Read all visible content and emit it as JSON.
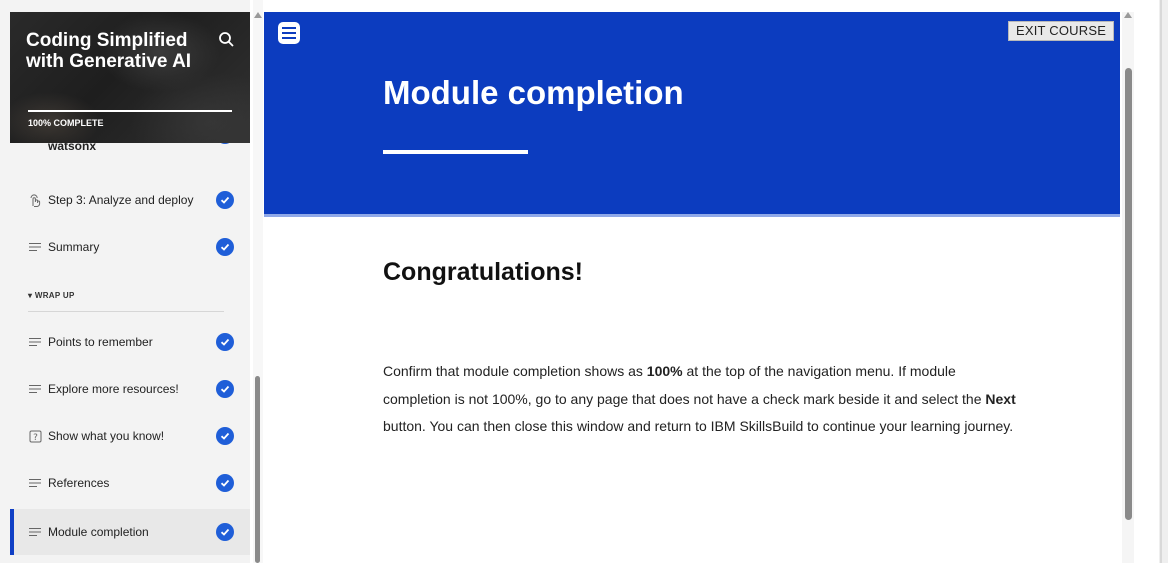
{
  "sidebar": {
    "course_title": "Coding Simplified with Generative AI",
    "progress_label": "100% COMPLETE",
    "progress": 1.0,
    "search_icon": "search-icon",
    "partial_item_label": "watsonx",
    "items": [
      {
        "label": "Step 3: Analyze and deploy",
        "icon": "touch-icon",
        "completed": true
      },
      {
        "label": "Summary",
        "icon": "lines-icon",
        "completed": true
      },
      {
        "label": "Points to remember",
        "icon": "lines-icon",
        "completed": true
      },
      {
        "label": "Explore more resources!",
        "icon": "lines-icon",
        "completed": true
      },
      {
        "label": "Show what you know!",
        "icon": "question-icon",
        "completed": true
      },
      {
        "label": "References",
        "icon": "lines-icon",
        "completed": true
      },
      {
        "label": "Module completion",
        "icon": "lines-icon",
        "completed": true,
        "active": true
      }
    ],
    "section_label": "WRAP UP"
  },
  "header": {
    "exit_label": "EXIT COURSE",
    "page_title": "Module completion"
  },
  "content": {
    "heading": "Congratulations!",
    "p1": "Confirm that module completion shows as ",
    "p1_bold": "100%",
    "p2": " at the top of the navigation menu. If module completion is not 100%, go to any page that does not have a check mark beside it and select the ",
    "p2_bold": "Next",
    "p3": " button. You can then close this window and return to IBM SkillsBuild to continue your learning journey."
  },
  "colors": {
    "banner": "#0c3cbf",
    "check": "#1f5ed8",
    "active_bar": "#0f3fc5"
  }
}
